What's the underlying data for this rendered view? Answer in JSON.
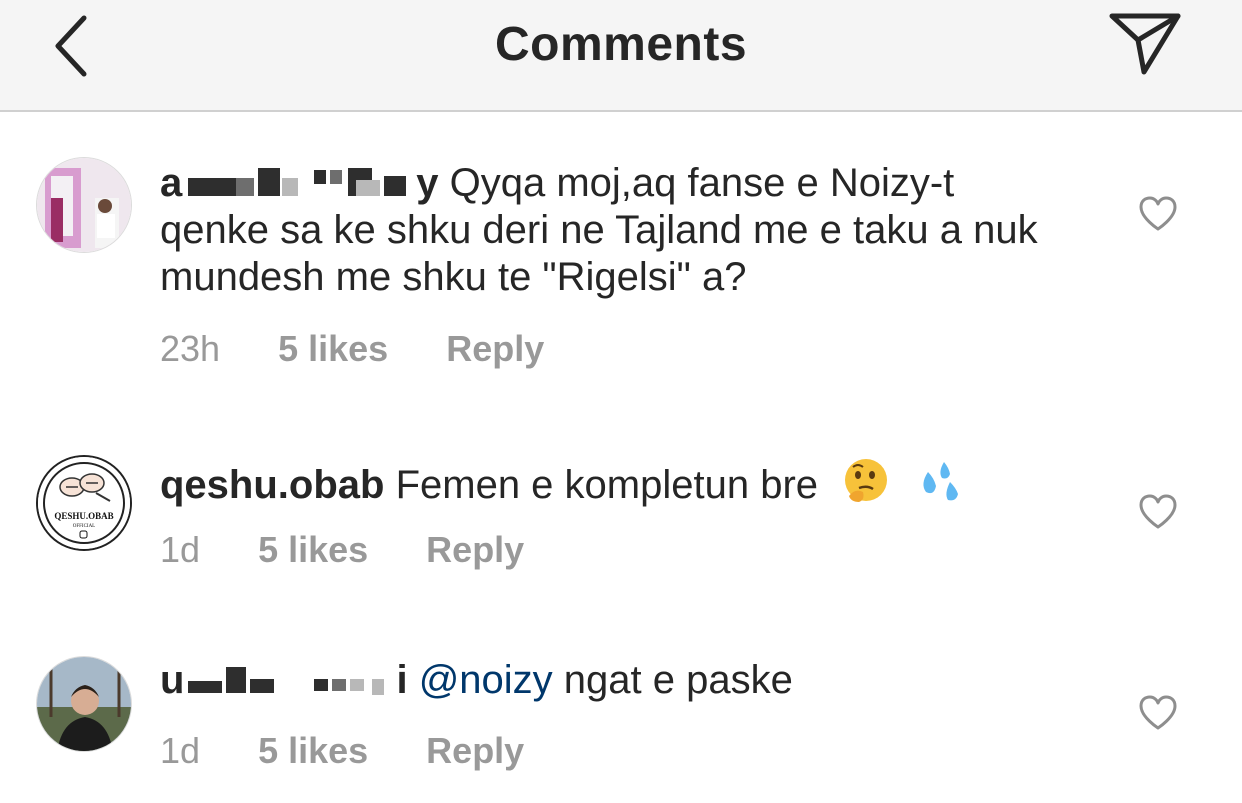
{
  "header": {
    "title": "Comments"
  },
  "comments": [
    {
      "username_visible": "a",
      "username_suffix": "y",
      "text": "Qyqa moj,aq fanse e Noizy-t qenke sa ke shku deri ne Tajland me e taku a nuk mundesh me shku te \"Rigelsi\" a?",
      "time": "23h",
      "likes": "5 likes",
      "reply": "Reply"
    },
    {
      "username": "qeshu.obab",
      "text": "Femen e kompletun bre",
      "emojis": [
        "thinking-face-emoji",
        "sweat-droplets-emoji"
      ],
      "avatar_text": "QESHU.OBAB",
      "avatar_subtext": "OFFICIAL",
      "time": "1d",
      "likes": "5 likes",
      "reply": "Reply"
    },
    {
      "username_visible": "u",
      "username_suffix": "i",
      "mention": "@noizy",
      "text": "ngat e paske",
      "time": "1d",
      "likes": "5 likes",
      "reply": "Reply"
    }
  ],
  "colors": {
    "header_bg": "#f5f5f5",
    "text": "#262626",
    "meta": "#999999",
    "mention": "#00376b"
  }
}
